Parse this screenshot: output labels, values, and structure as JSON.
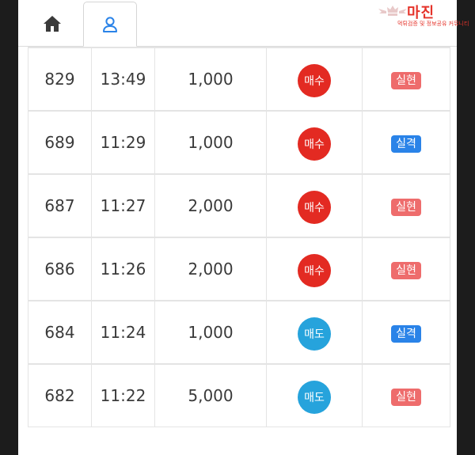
{
  "tabs": [
    {
      "name": "home",
      "icon": "home-icon",
      "active": false
    },
    {
      "name": "user",
      "icon": "user-icon",
      "active": true
    }
  ],
  "watermark": {
    "brand": "마진",
    "tagline": "먹튀검증 및 정보공유 커뮤니티"
  },
  "trades": [
    {
      "no": "829",
      "time": "13:49",
      "qty": "1,000",
      "side": "매수",
      "side_type": "buy",
      "result": "실현",
      "result_type": "win"
    },
    {
      "no": "689",
      "time": "11:29",
      "qty": "1,000",
      "side": "매수",
      "side_type": "buy",
      "result": "실격",
      "result_type": "lose"
    },
    {
      "no": "687",
      "time": "11:27",
      "qty": "2,000",
      "side": "매수",
      "side_type": "buy",
      "result": "실현",
      "result_type": "win"
    },
    {
      "no": "686",
      "time": "11:26",
      "qty": "2,000",
      "side": "매수",
      "side_type": "buy",
      "result": "실현",
      "result_type": "win"
    },
    {
      "no": "684",
      "time": "11:24",
      "qty": "1,000",
      "side": "매도",
      "side_type": "sell",
      "result": "실격",
      "result_type": "lose"
    },
    {
      "no": "682",
      "time": "11:22",
      "qty": "5,000",
      "side": "매도",
      "side_type": "sell",
      "result": "실현",
      "result_type": "win"
    }
  ],
  "colors": {
    "buy": "#e32a22",
    "sell": "#26a3dc",
    "win": "#ee6c6c",
    "lose": "#2a83e8",
    "user_icon": "#2a83e8"
  }
}
